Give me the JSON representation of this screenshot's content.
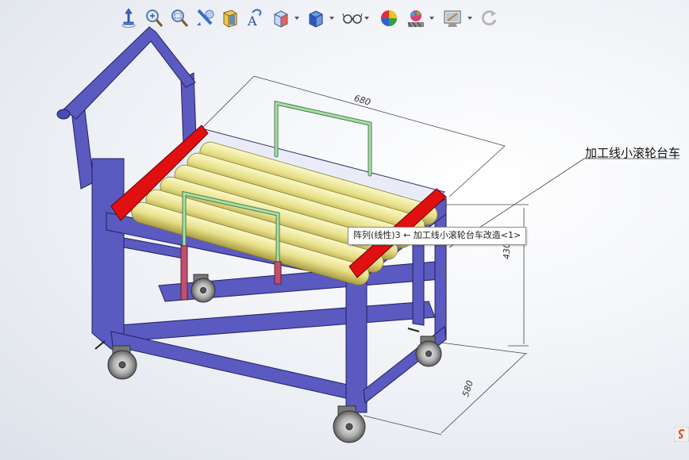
{
  "toolbar": {
    "tools": [
      {
        "icon": "view-orient-icon"
      },
      {
        "icon": "zoom-to-fit-icon"
      },
      {
        "icon": "zoom-area-icon"
      },
      {
        "icon": "previous-view-icon"
      },
      {
        "icon": "section-view-icon"
      },
      {
        "icon": "dynamic-annotation-icon"
      },
      {
        "icon": "view-orientation-icon"
      },
      {
        "icon": "display-style-icon"
      },
      {
        "icon": "hide-show-icon"
      },
      {
        "icon": "edit-appearance-icon"
      },
      {
        "icon": "apply-scene-icon"
      },
      {
        "icon": "view-settings-icon"
      },
      {
        "icon": "rotate-icon"
      }
    ]
  },
  "model": {
    "callout": "加工线小滚轮台车",
    "dimensions": {
      "length": "680",
      "height": "430",
      "width": "580"
    }
  },
  "tooltip": {
    "text": "阵列(线性)3 ← 加工线小滚轮台车改造<1>"
  },
  "colors": {
    "frame": "#5050b8",
    "rollers": "#e8e08a",
    "side_rails": "#e01010",
    "handles": "#90c890"
  }
}
